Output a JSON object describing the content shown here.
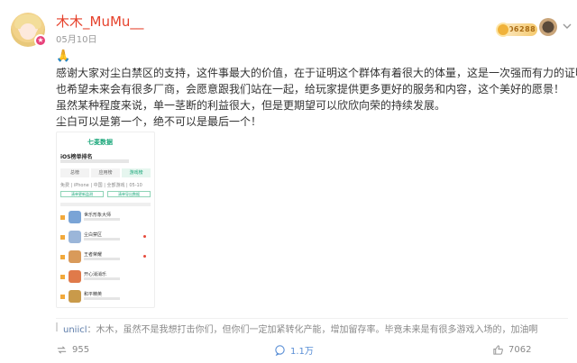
{
  "post": {
    "username": "木木_MuMu__",
    "time": "05月10日",
    "fan_badge": "006288",
    "emoji": "🙏",
    "paragraphs": [
      "感谢大家对尘白禁区的支持，这件事最大的价值，在于证明这个群体有着很大的体量，这是一次强而有力的证明！",
      "也希望未来会有很多厂商，会愿意跟我们站在一起，给玩家提供更多更好的服务和内容，这个美好的愿景！",
      "虽然某种程度来说，单一茎断的利益很大，但是更期望可以欣欣向荣的持续发展。",
      "尘白可以是第一个，绝不可以是最后一个！"
    ]
  },
  "screenshot": {
    "brand": "七麦数据",
    "title": "iOS榜单排名",
    "tabs": [
      "总榜",
      "应用榜",
      "游戏榜"
    ],
    "filter": "免费 | iPhone | 中国 | 全部游戏 | 05-10",
    "buttons": [
      "清单更新监测",
      "清单导出数据"
    ],
    "apps": [
      {
        "name": "世乐形象大师",
        "color": "#7aa4d6"
      },
      {
        "name": "尘白禁区",
        "color": "#9bb6d9"
      },
      {
        "name": "王者荣耀",
        "color": "#d99a5a"
      },
      {
        "name": "开心消消乐",
        "color": "#e07a4a"
      },
      {
        "name": "和平精英",
        "color": "#c99a4a"
      }
    ]
  },
  "repost": {
    "name": "uniicl",
    "text": "：木木，虽然不是我想打击你们，但你们一定加紧转化产能，增加留存率。毕竟未来是有很多游戏入场的，加油啊"
  },
  "actions": {
    "repost_count": "955",
    "comment_count": "1.1万",
    "like_count": "7062"
  },
  "colors": {
    "username": "#e6412b",
    "accent_blue": "#5a8fd6",
    "brand_green": "#1aa77a"
  }
}
